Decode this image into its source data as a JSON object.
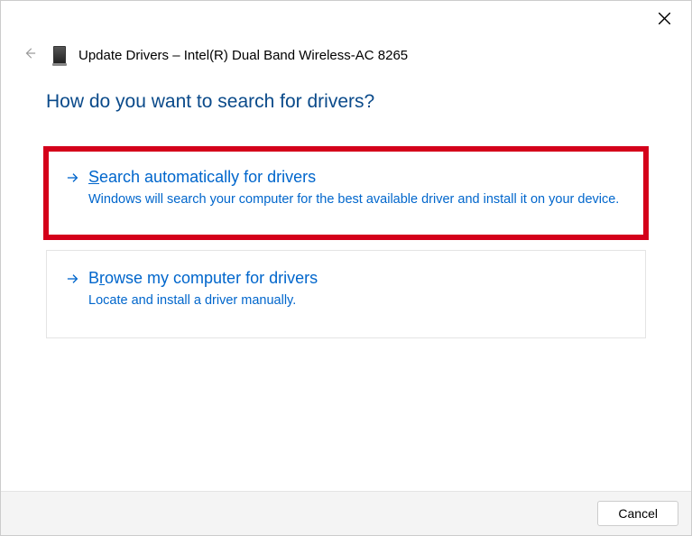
{
  "window": {
    "title": "Update Drivers – Intel(R) Dual Band Wireless-AC 8265"
  },
  "heading": "How do you want to search for drivers?",
  "options": [
    {
      "title_prefix": "S",
      "title_rest": "earch automatically for drivers",
      "desc": "Windows will search your computer for the best available driver and install it on your device."
    },
    {
      "title_prefix": "B",
      "title_mid": "r",
      "title_rest": "owse my computer for drivers",
      "desc": "Locate and install a driver manually."
    }
  ],
  "buttons": {
    "cancel": "Cancel"
  }
}
